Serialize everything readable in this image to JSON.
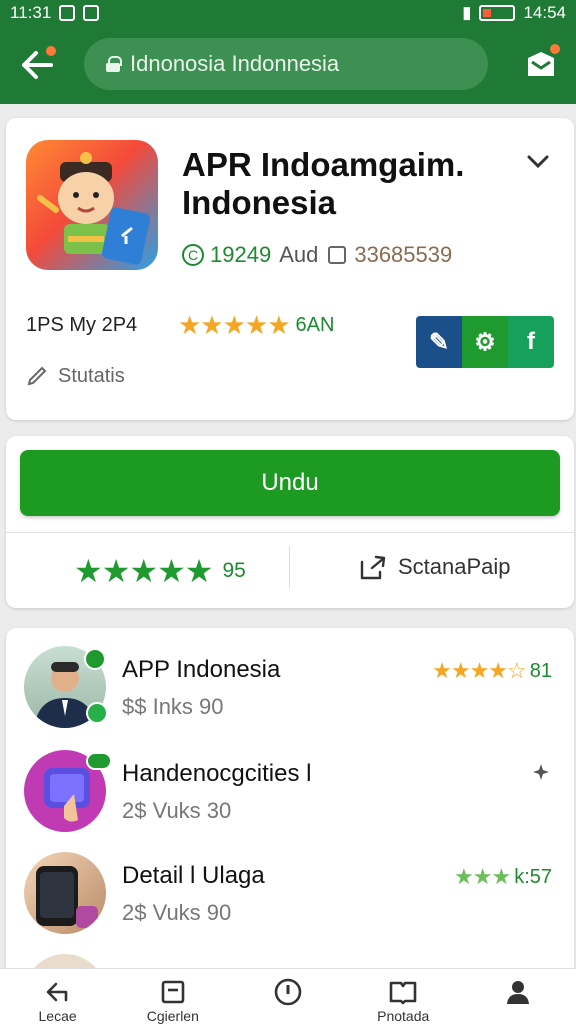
{
  "status_bar": {
    "time_left": "11:31",
    "time_right": "14:54"
  },
  "app_bar": {
    "url": "Idnonosia Indonnesia"
  },
  "app": {
    "title": "APR Indoamgaim. Indonesia",
    "version": "19249",
    "type": "Aud",
    "count": "33685539",
    "date": "1PS My 2P4",
    "rating_stars": "★★★★★",
    "rating_value": "6AN",
    "status_label": "Stutatis",
    "tools": [
      "pencil-icon",
      "gear-icon",
      "facebook-icon"
    ],
    "tool_colors": [
      "#1a4f8a",
      "#1e9a2e",
      "#17a05a"
    ]
  },
  "action": {
    "download_label": "Undu",
    "rating_stars": "★★★★★",
    "rating_value": "95",
    "share_label": "SctanaPaip"
  },
  "list": [
    {
      "title": "APP Indonesia",
      "subtitle": "$$ Inks  90",
      "stars": "★★★★☆",
      "rating": "81",
      "star_color": "orange"
    },
    {
      "title": "Handenocgcities l",
      "subtitle": "2$ Vuks  30",
      "stars": "",
      "rating": "",
      "star_color": "none"
    },
    {
      "title": "Detail l Ulaga",
      "subtitle": "2$ Vuks  90",
      "stars": "★★★",
      "rating": "k:57",
      "star_color": "green"
    }
  ],
  "bottom_nav": [
    {
      "label": "Lecae",
      "icon": "back-arrow-icon"
    },
    {
      "label": "Cgierlen",
      "icon": "document-icon"
    },
    {
      "label": "",
      "icon": "info-icon"
    },
    {
      "label": "Pnotada",
      "icon": "book-icon"
    },
    {
      "label": "",
      "icon": "profile-icon"
    }
  ]
}
